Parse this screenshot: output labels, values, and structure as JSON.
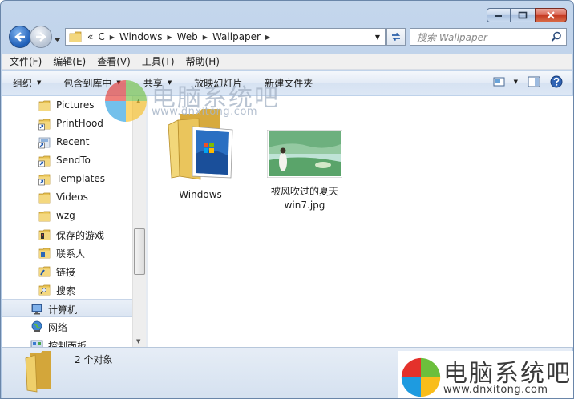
{
  "window": {
    "caption": {
      "minimize": "minimize",
      "maximize": "maximize",
      "close": "close"
    }
  },
  "address": {
    "overflow": "«",
    "crumbs": [
      "C",
      "Windows",
      "Web",
      "Wallpaper"
    ],
    "search_placeholder": "搜索 Wallpaper"
  },
  "menu": {
    "items": [
      "文件(F)",
      "编辑(E)",
      "查看(V)",
      "工具(T)",
      "帮助(H)"
    ]
  },
  "commands": {
    "organize": "组织",
    "include_in_library": "包含到库中",
    "share": "共享",
    "slideshow": "放映幻灯片",
    "new_folder": "新建文件夹"
  },
  "nav": {
    "items": [
      {
        "label": "Pictures",
        "icon": "folder-icon"
      },
      {
        "label": "PrintHood",
        "icon": "shortcut-folder-icon"
      },
      {
        "label": "Recent",
        "icon": "shortcut-folder-icon"
      },
      {
        "label": "SendTo",
        "icon": "shortcut-folder-icon"
      },
      {
        "label": "Templates",
        "icon": "shortcut-folder-icon"
      },
      {
        "label": "Videos",
        "icon": "folder-icon"
      },
      {
        "label": "wzg",
        "icon": "folder-icon"
      },
      {
        "label": "保存的游戏",
        "icon": "saved-games-icon"
      },
      {
        "label": "联系人",
        "icon": "contacts-icon"
      },
      {
        "label": "链接",
        "icon": "links-icon"
      },
      {
        "label": "搜索",
        "icon": "searches-icon"
      },
      {
        "label": "计算机",
        "icon": "computer-icon"
      },
      {
        "label": "网络",
        "icon": "network-icon"
      },
      {
        "label": "控制面板",
        "icon": "control-panel-icon"
      }
    ]
  },
  "files": [
    {
      "name": "Windows",
      "type": "folder"
    },
    {
      "name_line1": "被风吹过的夏天",
      "name_line2": "win7.jpg",
      "type": "image"
    }
  ],
  "status": {
    "count": "2 个对象"
  },
  "watermark": {
    "title": "电脑系统吧",
    "url": "www.dnxitong.com"
  },
  "colors": {
    "accent": "#1f5fb8",
    "frame": "#b6cce6",
    "close": "#c43a22"
  }
}
